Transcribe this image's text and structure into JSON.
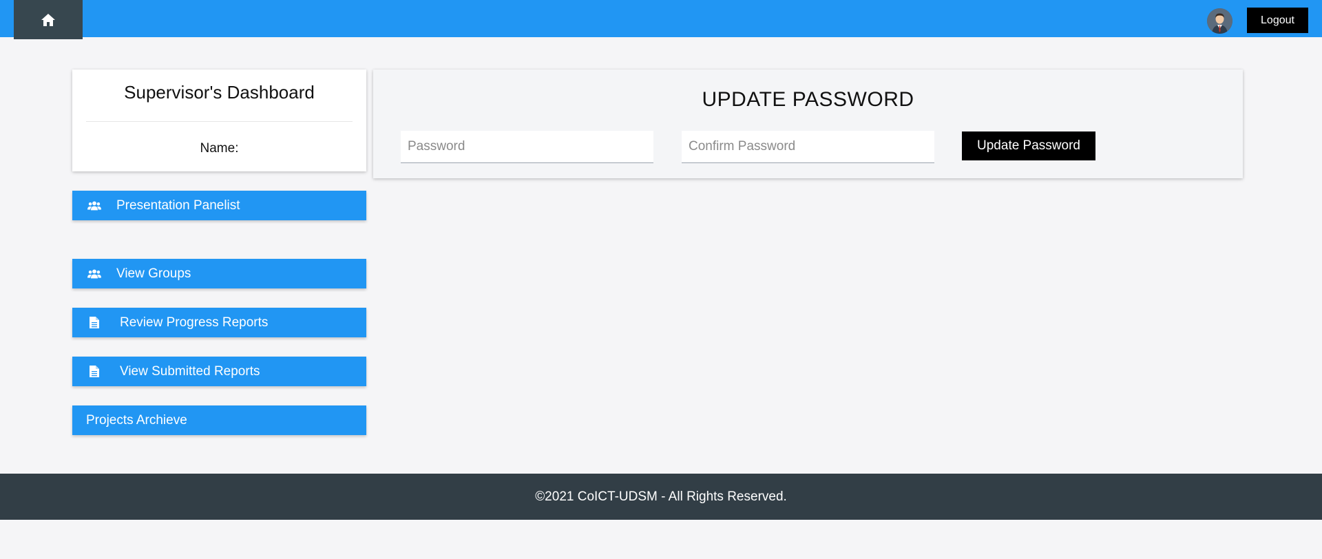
{
  "topbar": {
    "home_icon": "home-icon",
    "logout_label": "Logout",
    "avatar_icon": "user-avatar",
    "color": "#2196f3"
  },
  "sidebar": {
    "dashboard_title": "Supervisor's Dashboard",
    "name_label": "Name:",
    "items": [
      {
        "label": "Presentation Panelist",
        "icon": "users-icon"
      },
      {
        "label": "View Groups",
        "icon": "users-icon"
      },
      {
        "label": "Review Progress Reports",
        "icon": "file-icon"
      },
      {
        "label": "View Submitted Reports",
        "icon": "file-icon"
      },
      {
        "label": "Projects Archieve",
        "icon": ""
      }
    ]
  },
  "update_password": {
    "title": "UPDATE PASSWORD",
    "password_placeholder": "Password",
    "password_value": "",
    "confirm_placeholder": "Confirm Password",
    "confirm_value": "",
    "button_label": "Update Password"
  },
  "footer": {
    "text": "©2021 CoICT-UDSM - All Rights Reserved.",
    "color": "#323e46"
  }
}
